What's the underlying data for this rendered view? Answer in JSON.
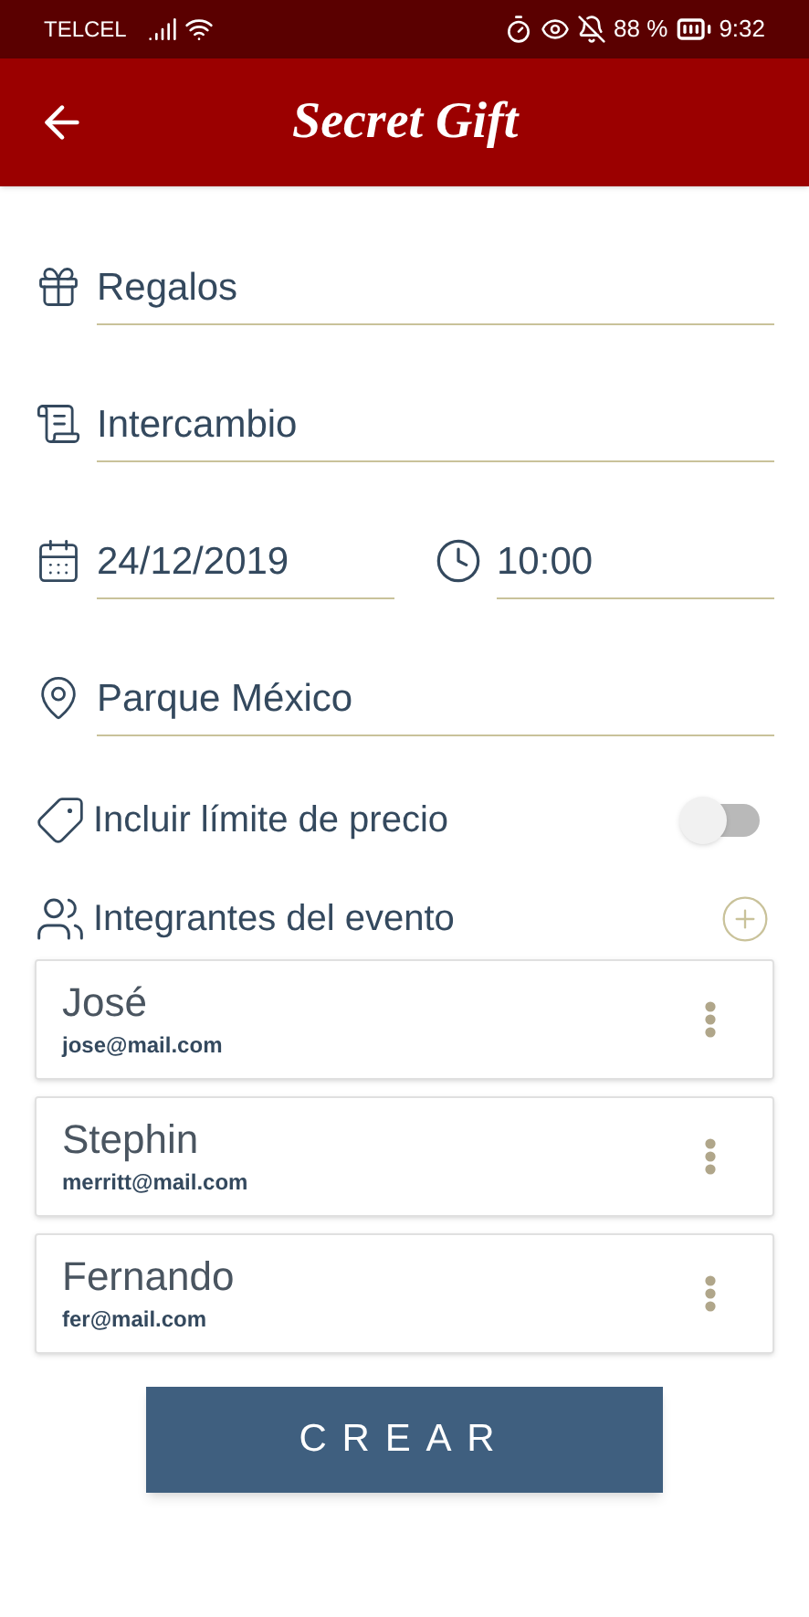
{
  "status_bar": {
    "carrier": "TELCEL",
    "battery": "88 %",
    "time": "9:32"
  },
  "app_bar": {
    "title": "Secret Gift"
  },
  "fields": [
    {
      "kind": "gift",
      "value": "Regalos"
    },
    {
      "kind": "list",
      "value": "Intercambio"
    }
  ],
  "date_time": {
    "date": "24/12/2019",
    "time": "10:00"
  },
  "location": {
    "value": "Parque México"
  },
  "price_limit": {
    "label": "Incluir límite de precio",
    "on": false
  },
  "members": {
    "label": "Integrantes del evento",
    "items": [
      {
        "name": "José",
        "email": "jose@mail.com"
      },
      {
        "name": "Stephin",
        "email": "merritt@mail.com"
      },
      {
        "name": "Fernando",
        "email": "fer@mail.com"
      }
    ]
  },
  "create_button": "CREAR"
}
